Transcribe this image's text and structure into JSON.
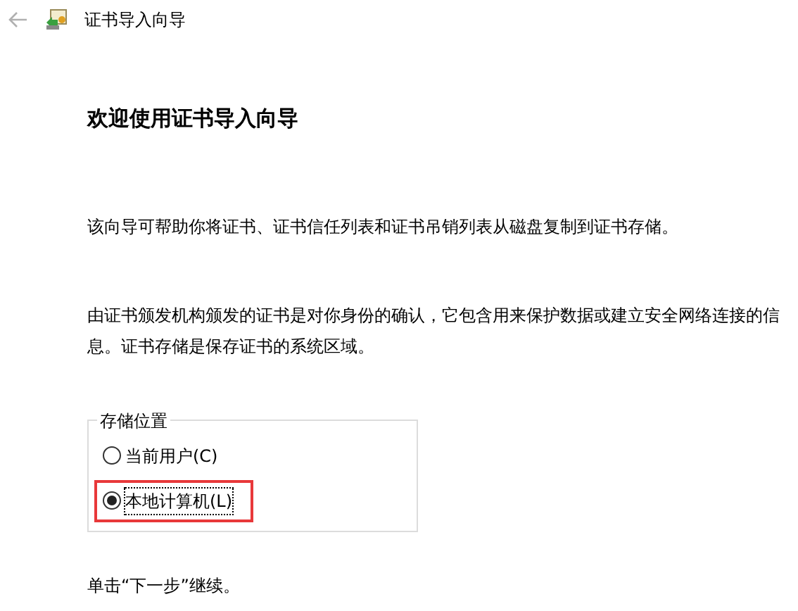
{
  "window": {
    "title": "证书导入向导"
  },
  "heading": "欢迎使用证书导入向导",
  "paragraphs": [
    "该向导可帮助你将证书、证书信任列表和证书吊销列表从磁盘复制到证书存储。",
    "由证书颁发机构颁发的证书是对你身份的确认，它包含用来保护数据或建立安全网络连接的信息。证书存储是保存证书的系统区域。"
  ],
  "store_location": {
    "label": "存储位置",
    "options": [
      {
        "label": "当前用户(C)",
        "selected": false,
        "highlighted": false
      },
      {
        "label": "本地计算机(L)",
        "selected": true,
        "highlighted": true
      }
    ]
  },
  "footer": "单击“下一步”继续。"
}
